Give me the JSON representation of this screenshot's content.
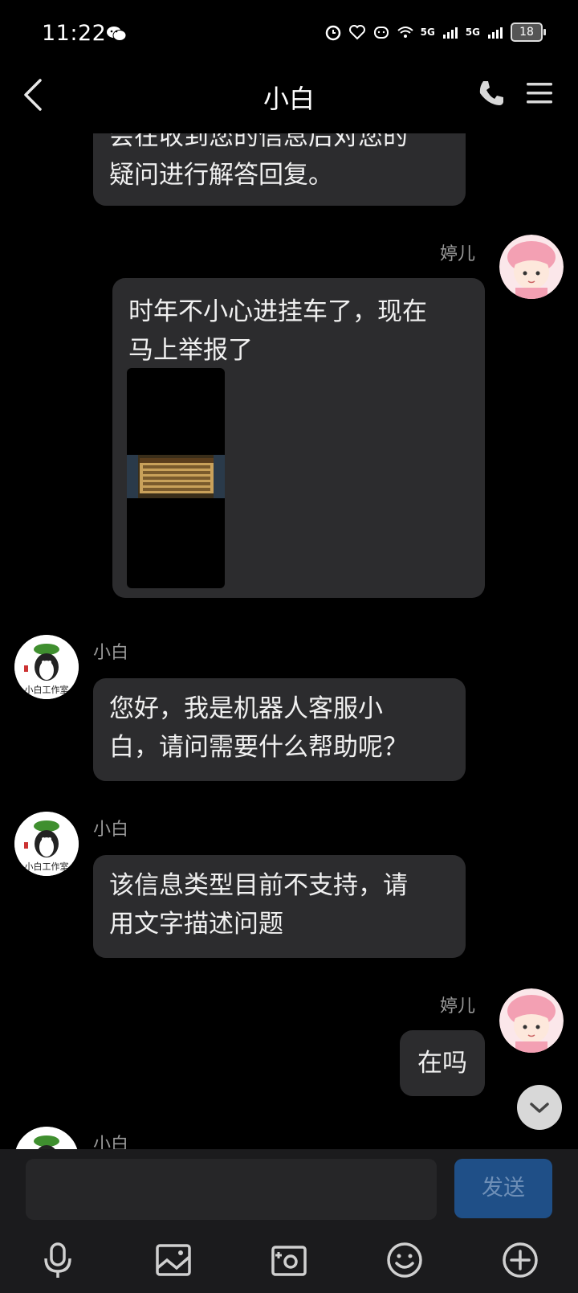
{
  "status_bar": {
    "time": "11:22",
    "battery": "18",
    "signal1": "5G",
    "signal2": "5G"
  },
  "header": {
    "title": "小白"
  },
  "messages": {
    "m0": {
      "line1": "会在收到您的信息后对您的",
      "line2": "疑问进行解答回复。"
    },
    "m1": {
      "sender": "婷儿",
      "line1": "时年不小心进挂车了，现在",
      "line2": "马上举报了"
    },
    "m2": {
      "sender": "小白",
      "line1": "您好，我是机器人客服小",
      "line2": "白，请问需要什么帮助呢？"
    },
    "m3": {
      "sender": "小白",
      "line1": "该信息类型目前不支持，请",
      "line2": "用文字描述问题"
    },
    "m4": {
      "sender": "婷儿",
      "text": "在吗"
    },
    "m5": {
      "sender": "小白"
    }
  },
  "bot_avatar_caption": "小白工作室",
  "input": {
    "placeholder": "",
    "send_label": "发送"
  },
  "toolbar_icons": [
    "microphone-icon",
    "image-icon",
    "camera-icon",
    "emoji-icon",
    "plus-icon"
  ],
  "colors": {
    "background": "#000000",
    "bubble": "#2c2c2e",
    "send_button": "#1f4f87"
  }
}
